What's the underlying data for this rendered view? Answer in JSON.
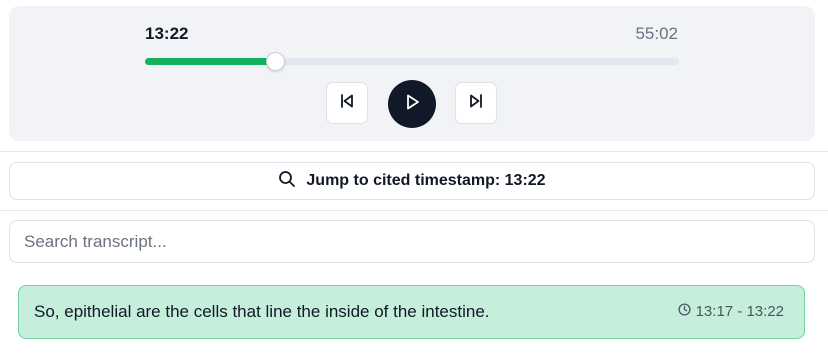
{
  "player": {
    "current_time": "13:22",
    "total_time": "55:02",
    "progress_fraction": 0.243,
    "accent_color": "#12b25c",
    "controls": {
      "previous_icon": "skip-back-icon",
      "play_icon": "play-icon",
      "next_icon": "skip-forward-icon"
    }
  },
  "jump": {
    "icon": "search-icon",
    "label": "Jump to cited timestamp: 13:22"
  },
  "search": {
    "placeholder": "Search transcript...",
    "value": ""
  },
  "transcript": {
    "active_segment": {
      "text": "So, epithelial are the cells that line the inside of the intestine.",
      "time_icon": "clock-icon",
      "time_range": "13:17 - 13:22",
      "highlight_color": "#c5eedb"
    }
  }
}
